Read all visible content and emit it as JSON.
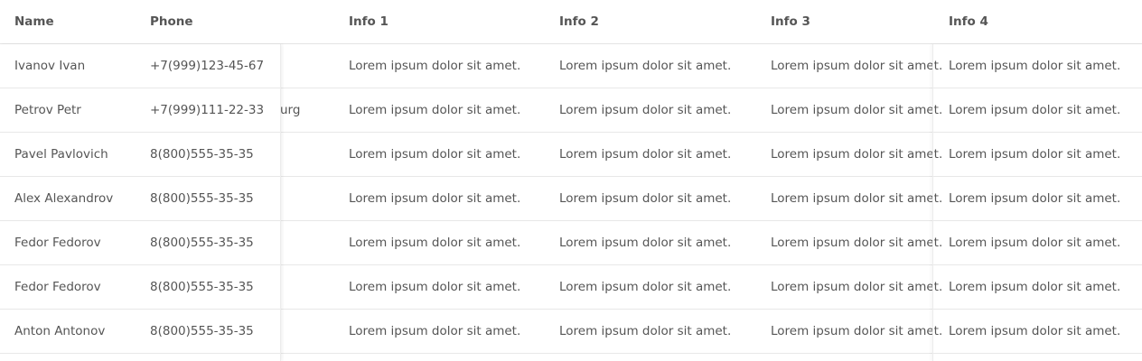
{
  "columns": {
    "name": "Name",
    "phone": "Phone",
    "info1": "Info 1",
    "info2": "Info 2",
    "info3": "Info 3",
    "info4": "Info 4"
  },
  "rows": [
    {
      "name": "Ivanov Ivan",
      "phone": "+7(999)123-45-67",
      "city": "",
      "info1": "Lorem ipsum dolor sit amet.",
      "info2": "Lorem ipsum dolor sit amet.",
      "info3": "Lorem ipsum dolor sit amet.",
      "info4": "Lorem ipsum dolor sit amet."
    },
    {
      "name": "Petrov Petr",
      "phone": "+7(999)111-22-33",
      "city": "urg",
      "info1": "Lorem ipsum dolor sit amet.",
      "info2": "Lorem ipsum dolor sit amet.",
      "info3": "Lorem ipsum dolor sit amet.",
      "info4": "Lorem ipsum dolor sit amet."
    },
    {
      "name": "Pavel Pavlovich",
      "phone": "8(800)555-35-35",
      "city": "",
      "info1": "Lorem ipsum dolor sit amet.",
      "info2": "Lorem ipsum dolor sit amet.",
      "info3": "Lorem ipsum dolor sit amet.",
      "info4": "Lorem ipsum dolor sit amet."
    },
    {
      "name": "Alex Alexandrov",
      "phone": "8(800)555-35-35",
      "city": "",
      "info1": "Lorem ipsum dolor sit amet.",
      "info2": "Lorem ipsum dolor sit amet.",
      "info3": "Lorem ipsum dolor sit amet.",
      "info4": "Lorem ipsum dolor sit amet."
    },
    {
      "name": "Fedor Fedorov",
      "phone": "8(800)555-35-35",
      "city": "",
      "info1": "Lorem ipsum dolor sit amet.",
      "info2": "Lorem ipsum dolor sit amet.",
      "info3": "Lorem ipsum dolor sit amet.",
      "info4": "Lorem ipsum dolor sit amet."
    },
    {
      "name": "Fedor Fedorov",
      "phone": "8(800)555-35-35",
      "city": "",
      "info1": "Lorem ipsum dolor sit amet.",
      "info2": "Lorem ipsum dolor sit amet.",
      "info3": "Lorem ipsum dolor sit amet.",
      "info4": "Lorem ipsum dolor sit amet."
    },
    {
      "name": "Anton Antonov",
      "phone": "8(800)555-35-35",
      "city": "",
      "info1": "Lorem ipsum dolor sit amet.",
      "info2": "Lorem ipsum dolor sit amet.",
      "info3": "Lorem ipsum dolor sit amet.",
      "info4": "Lorem ipsum dolor sit amet."
    }
  ]
}
